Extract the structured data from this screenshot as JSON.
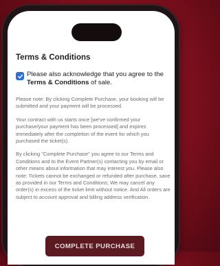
{
  "modal": {
    "title": "Terms & Conditions",
    "acknowledgement": {
      "checked": true,
      "text_before": "Please also acknowledge that you agree to the ",
      "link": "Terms & Conditions",
      "text_after": " of sale."
    },
    "paragraphs": [
      "Please note: By clicking Complete Purchase, your booking will be submitted and your payment will be processed.",
      "Your contract with us starts once [we've confirmed your purchase/your payment has been processed] and expires immediately after the completion of the event for which you purchased the ticket(s).",
      "By clicking \"Complete Purchase\" you agree to our Terms and Conditions and to the Event Partner(s) contacting you by email or other means about information that may interest you. Please also note: Tickets cannot be exchanged or refunded after purchase, save as provided in our Terms and Conditions; We may cancel any order(s) in excess of the ticket limit without notice. And All orders are subject to account approval and billing address verification."
    ],
    "complete_button": "COMPLETE PURCHASE"
  },
  "colors": {
    "background": "#7a0f1c",
    "checkbox": "#2f6fd6",
    "button": "#5a1a20"
  },
  "icons": {
    "checkbox": "checkmark-icon"
  }
}
